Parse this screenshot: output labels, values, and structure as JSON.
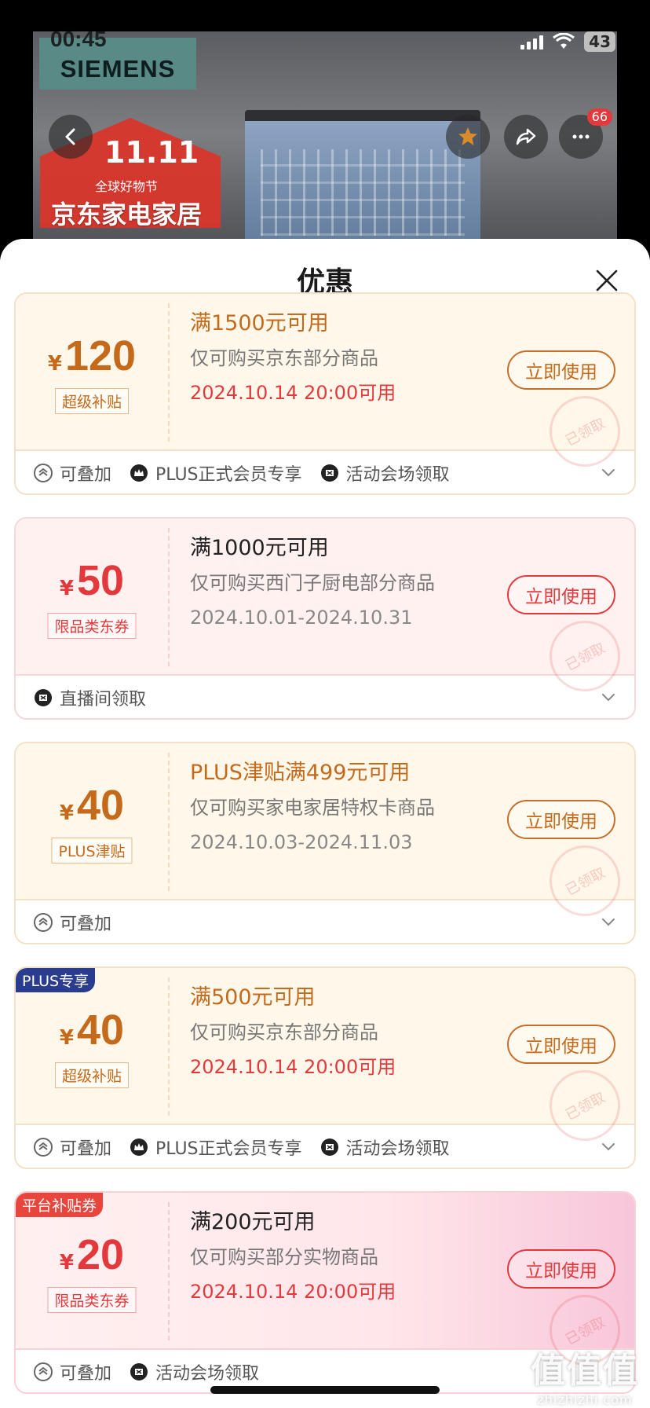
{
  "status_bar": {
    "time": "00:45",
    "battery": "43"
  },
  "hero": {
    "brand": "SIEMENS",
    "promo_date": "11.11",
    "promo_sub": "全球好物节",
    "promo_main": "京东家电家居",
    "cart_badge": "66"
  },
  "sheet": {
    "title": "优惠"
  },
  "coupons": [
    {
      "style": "gold",
      "corner_tag": "",
      "currency": "¥",
      "amount": "120",
      "tag": "超级补贴",
      "condition": "满1500元可用",
      "scope": "仅可购买京东部分商品",
      "validity": "2024.10.14 20:00可用",
      "button": "立即使用",
      "stamp": "已领取",
      "footer": [
        "可叠加",
        "PLUS正式会员专享",
        "活动会场领取"
      ]
    },
    {
      "style": "red",
      "corner_tag": "",
      "currency": "¥",
      "amount": "50",
      "tag": "限品类东券",
      "condition": "满1000元可用",
      "scope": "仅可购买西门子厨电部分商品",
      "validity": "2024.10.01-2024.10.31",
      "button": "立即使用",
      "stamp": "已领取",
      "footer": [
        "直播间领取"
      ]
    },
    {
      "style": "gold",
      "corner_tag": "",
      "currency": "¥",
      "amount": "40",
      "tag": "PLUS津贴",
      "condition": "PLUS津贴满499元可用",
      "scope": "仅可购买家电家居特权卡商品",
      "validity": "2024.10.03-2024.11.03",
      "button": "立即使用",
      "stamp": "已领取",
      "footer": [
        "可叠加"
      ]
    },
    {
      "style": "gold",
      "corner_tag": "PLUS专享",
      "currency": "¥",
      "amount": "40",
      "tag": "超级补贴",
      "condition": "满500元可用",
      "scope": "仅可购买京东部分商品",
      "validity": "2024.10.14 20:00可用",
      "button": "立即使用",
      "stamp": "已领取",
      "footer": [
        "可叠加",
        "PLUS正式会员专享",
        "活动会场领取"
      ]
    },
    {
      "style": "pink",
      "corner_tag": "平台补贴券",
      "currency": "¥",
      "amount": "20",
      "tag": "限品类东券",
      "condition": "满200元可用",
      "scope": "仅可购买部分实物商品",
      "validity": "2024.10.14 20:00可用",
      "button": "立即使用",
      "stamp": "已领取",
      "footer": [
        "可叠加",
        "活动会场领取"
      ]
    }
  ],
  "watermark": {
    "big": "值值值",
    "small": "zhizhizhi.com"
  }
}
